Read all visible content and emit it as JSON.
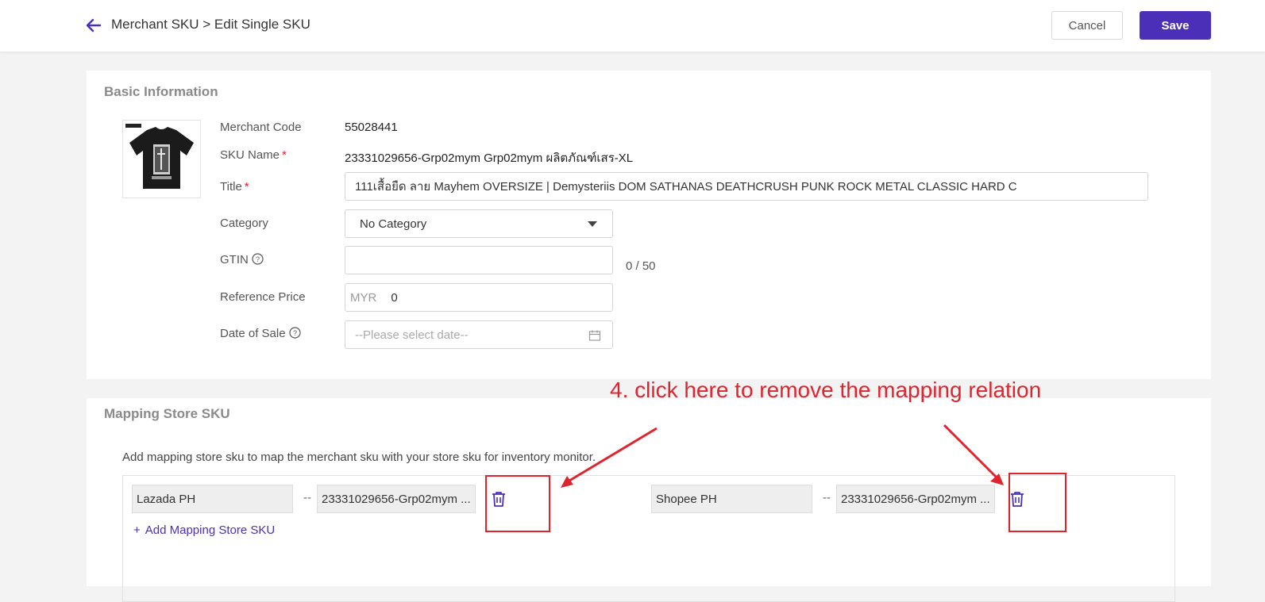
{
  "header": {
    "breadcrumb": "Merchant SKU > Edit Single SKU",
    "cancel_label": "Cancel",
    "save_label": "Save",
    "accent_color": "#4b2fb8"
  },
  "basic_info": {
    "section_title": "Basic Information",
    "merchant_code_label": "Merchant Code",
    "merchant_code_value": "55028441",
    "sku_name_label": "SKU Name",
    "sku_name_value": "23331029656-Grp02mym Grp02mym ผลิตภัณฑ์เสร-XL",
    "title_label": "Title",
    "title_value": "111เสื้อยืด ลาย Mayhem OVERSIZE | Demysteriis DOM SATHANAS DEATHCRUSH PUNK ROCK METAL CLASSIC HARD C",
    "required_mark": "*",
    "category_label": "Category",
    "category_value": "No Category",
    "gtin_label": "GTIN",
    "gtin_value": "",
    "gtin_counter": "0 / 50",
    "reference_price_label": "Reference Price",
    "currency": "MYR",
    "reference_price_value": "0",
    "date_of_sale_label": "Date of Sale",
    "date_placeholder": "--Please select date--"
  },
  "mapping": {
    "section_title": "Mapping Store SKU",
    "description": "Add mapping store sku to map the merchant sku with your store sku for inventory monitor.",
    "separator": "--",
    "rows": [
      {
        "store": "Lazada PH",
        "sku": "23331029656-Grp02mym ..."
      },
      {
        "store": "Shopee PH",
        "sku": "23331029656-Grp02mym ..."
      }
    ],
    "add_label": "Add Mapping Store SKU"
  },
  "annotation": {
    "text": "4. click here to remove the mapping relation",
    "color": "#e0242e"
  }
}
